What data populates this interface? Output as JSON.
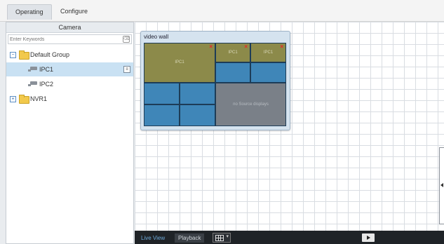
{
  "tabs": [
    {
      "label": "Operating",
      "active": true
    },
    {
      "label": "Configure",
      "active": false
    }
  ],
  "sidebar": {
    "header": "Camera",
    "search_placeholder": "Enter Keywords",
    "tree": {
      "group": "Default Group",
      "cameras": [
        "IPC1",
        "IPC2"
      ],
      "nvr": "NVR1"
    }
  },
  "video_wall": {
    "title": "video wall",
    "cells": [
      "IPC1",
      "IPC1",
      "IPC1",
      "no Source displays"
    ]
  },
  "bottom_bar": {
    "live_view": "Live View",
    "playback": "Playback"
  },
  "colors": {
    "accent": "#6da9d9",
    "selected_row": "#c9e1f3",
    "close_mark": "#ee2222"
  }
}
